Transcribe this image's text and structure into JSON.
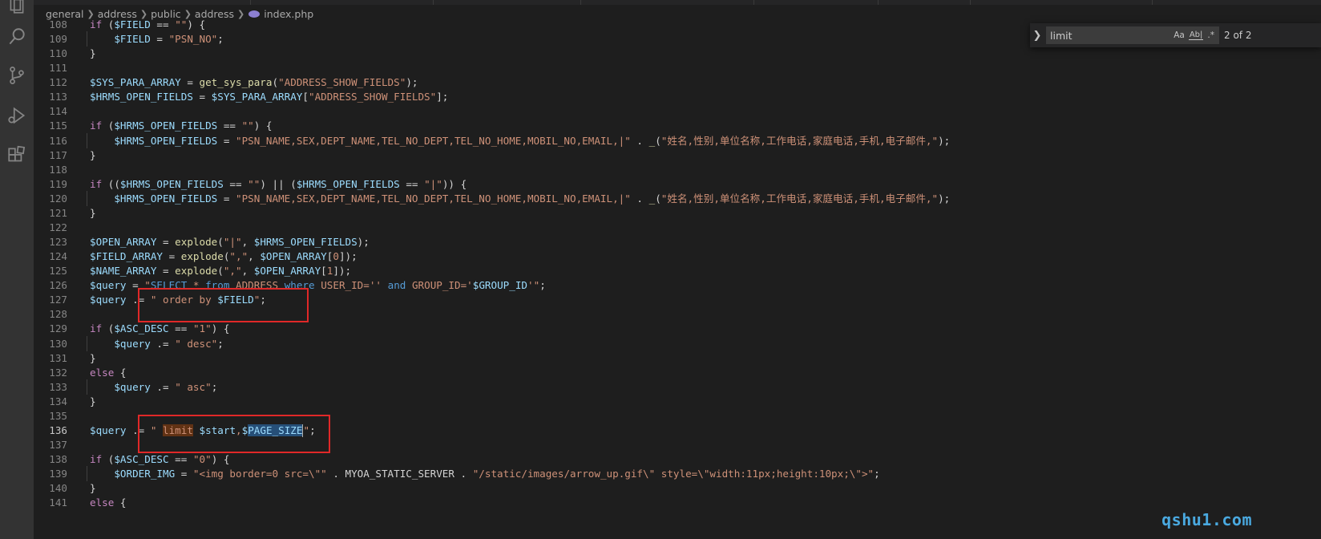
{
  "breadcrumb": {
    "segments": [
      "general",
      "address",
      "public",
      "address"
    ],
    "file": "index.php",
    "file_icon": "php-elephant-icon"
  },
  "find": {
    "query": "limit",
    "match_case": "Aa",
    "whole_word": "Ab|",
    "regex": ".*",
    "count": "2 of 2"
  },
  "lines": [
    {
      "n": "108",
      "html": "<span class=\"k\">if</span> (<span class=\"v\">$FIELD</span> == <span class=\"s\">\"\"</span>) {"
    },
    {
      "n": "109",
      "html": "    <span class=\"v\">$FIELD</span> = <span class=\"s\">\"PSN_NO\"</span>;"
    },
    {
      "n": "110",
      "html": "}"
    },
    {
      "n": "111",
      "html": ""
    },
    {
      "n": "112",
      "html": "<span class=\"v\">$SYS_PARA_ARRAY</span> = <span class=\"f\">get_sys_para</span>(<span class=\"s\">\"ADDRESS_SHOW_FIELDS\"</span>);"
    },
    {
      "n": "113",
      "html": "<span class=\"v\">$HRMS_OPEN_FIELDS</span> = <span class=\"v\">$SYS_PARA_ARRAY</span>[<span class=\"s\">\"ADDRESS_SHOW_FIELDS\"</span>];"
    },
    {
      "n": "114",
      "html": ""
    },
    {
      "n": "115",
      "html": "<span class=\"k\">if</span> (<span class=\"v\">$HRMS_OPEN_FIELDS</span> == <span class=\"s\">\"\"</span>) {"
    },
    {
      "n": "116",
      "html": "    <span class=\"v\">$HRMS_OPEN_FIELDS</span> = <span class=\"s\">\"PSN_NAME,SEX,DEPT_NAME,TEL_NO_DEPT,TEL_NO_HOME,MOBIL_NO,EMAIL,|\"</span> . <span class=\"f\">_</span>(<span class=\"s\">\"姓名,性别,单位名称,工作电话,家庭电话,手机,电子邮件,\"</span>);"
    },
    {
      "n": "117",
      "html": "}"
    },
    {
      "n": "118",
      "html": ""
    },
    {
      "n": "119",
      "html": "<span class=\"k\">if</span> ((<span class=\"v\">$HRMS_OPEN_FIELDS</span> == <span class=\"s\">\"\"</span>) || (<span class=\"v\">$HRMS_OPEN_FIELDS</span> == <span class=\"s\">\"|\"</span>)) {"
    },
    {
      "n": "120",
      "html": "    <span class=\"v\">$HRMS_OPEN_FIELDS</span> = <span class=\"s\">\"PSN_NAME,SEX,DEPT_NAME,TEL_NO_DEPT,TEL_NO_HOME,MOBIL_NO,EMAIL,|\"</span> . <span class=\"f\">_</span>(<span class=\"s\">\"姓名,性别,单位名称,工作电话,家庭电话,手机,电子邮件,\"</span>);"
    },
    {
      "n": "121",
      "html": "}"
    },
    {
      "n": "122",
      "html": ""
    },
    {
      "n": "123",
      "html": "<span class=\"v\">$OPEN_ARRAY</span> = <span class=\"f\">explode</span>(<span class=\"s\">\"|\"</span>, <span class=\"v\">$HRMS_OPEN_FIELDS</span>);"
    },
    {
      "n": "124",
      "html": "<span class=\"v\">$FIELD_ARRAY</span> = <span class=\"f\">explode</span>(<span class=\"s\">\",\"</span>, <span class=\"v\">$OPEN_ARRAY</span>[<span class=\"s\">0</span>]);"
    },
    {
      "n": "125",
      "html": "<span class=\"v\">$NAME_ARRAY</span> = <span class=\"f\">explode</span>(<span class=\"s\">\",\"</span>, <span class=\"v\">$OPEN_ARRAY</span>[<span class=\"s\">1</span>]);"
    },
    {
      "n": "126",
      "html": "<span class=\"v\">$query</span> = <span class=\"s\">\"</span><span class=\"sqlk\">SELECT</span><span class=\"s\"> * </span><span class=\"sqlk\">from</span><span class=\"s\"> ADDRESS </span><span class=\"sqlk\">where</span><span class=\"s\"> USER_ID='' </span><span class=\"sqlk\">and</span><span class=\"s\"> GROUP_ID='</span><span class=\"v\">$GROUP_ID</span><span class=\"s\">'\"</span>;"
    },
    {
      "n": "127",
      "html": "<span class=\"v\">$query</span> .= <span class=\"s\">\" order by </span><span class=\"v\">$FIELD</span><span class=\"s\">\"</span>;"
    },
    {
      "n": "128",
      "html": ""
    },
    {
      "n": "129",
      "html": "<span class=\"k\">if</span> (<span class=\"v\">$ASC_DESC</span> == <span class=\"s\">\"1\"</span>) {"
    },
    {
      "n": "130",
      "html": "    <span class=\"v\">$query</span> .= <span class=\"s\">\" desc\"</span>;"
    },
    {
      "n": "131",
      "html": "}"
    },
    {
      "n": "132",
      "html": "<span class=\"k\">else</span> {"
    },
    {
      "n": "133",
      "html": "    <span class=\"v\">$query</span> .= <span class=\"s\">\" asc\"</span>;"
    },
    {
      "n": "134",
      "html": "}"
    },
    {
      "n": "135",
      "html": ""
    },
    {
      "n": "136",
      "html": "<span class=\"v\">$query</span> .= <span class=\"s\">\" <span class=\"hl-find\">limit</span> </span><span class=\"v\">$start</span><span class=\"s\">,</span><span class=\"v\">$<span class=\"hl-sel\">PAGE_SIZE</span></span><span class=\"cursor\"></span><span class=\"s\">\"</span>;"
    },
    {
      "n": "137",
      "html": ""
    },
    {
      "n": "138",
      "html": "<span class=\"k\">if</span> (<span class=\"v\">$ASC_DESC</span> == <span class=\"s\">\"0\"</span>) {"
    },
    {
      "n": "139",
      "html": "    <span class=\"v\">$ORDER_IMG</span> = <span class=\"s\">\"&lt;img border=0 src=\\\"\"</span> . MYOA_STATIC_SERVER . <span class=\"s\">\"/static/images/arrow_up.gif\\\" style=\\\"width:11px;height:10px;\\\"&gt;\"</span>;"
    },
    {
      "n": "140",
      "html": "}"
    },
    {
      "n": "141",
      "html": "<span class=\"k\">else</span> {"
    }
  ],
  "active_line": "136",
  "watermark": "qshu1.com"
}
